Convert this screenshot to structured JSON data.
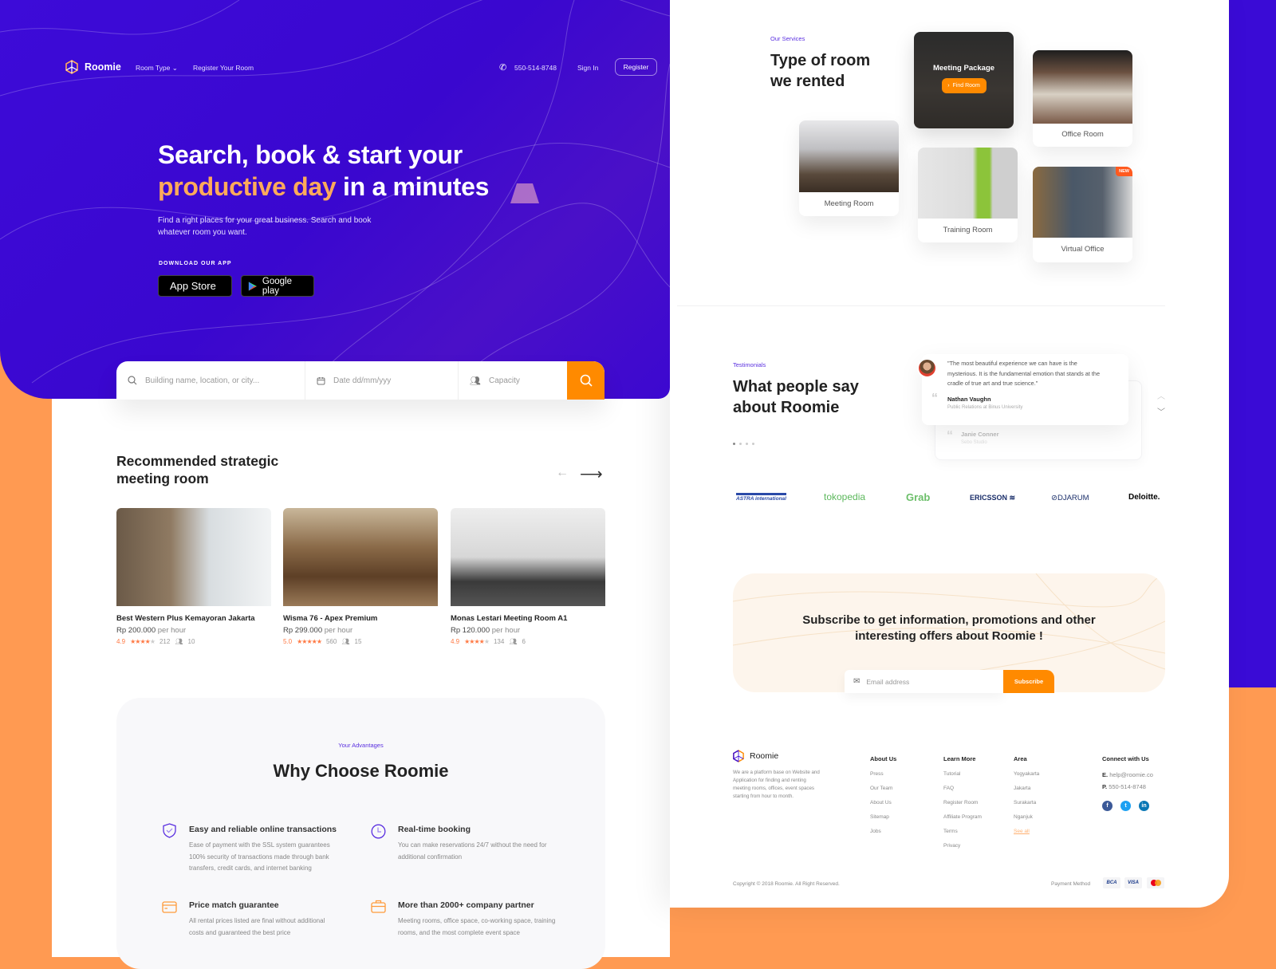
{
  "colors": {
    "brand_purple": "#3a0bd6",
    "accent_orange": "#ff8a00",
    "highlight_orange": "#ffaa5a",
    "star": "#ff7a45"
  },
  "nav": {
    "brand": "Roomie",
    "room_type": "Room Type",
    "register_room": "Register Your Room",
    "phone": "550-514-8748",
    "sign_in": "Sign In",
    "register": "Register"
  },
  "hero": {
    "title_line1": "Search, book & start your",
    "title_highlight": "productive day",
    "title_rest": " in a minutes",
    "subtitle": "Find a right places for your great business. Search and book whatever room you want.",
    "download_label": "DOWNLOAD OUR APP",
    "app_store": "App Store",
    "google_play": "Google play"
  },
  "search": {
    "location_placeholder": "Building name, location, or city...",
    "date_placeholder": "Date dd/mm/yyy",
    "capacity_placeholder": "Capacity"
  },
  "recommended": {
    "title_line1": "Recommended strategic",
    "title_line2": "meeting room",
    "rooms": [
      {
        "name": "Best Western Plus Kemayoran Jakarta",
        "price": "Rp 200.000",
        "unit": "per hour",
        "rating": "4.9",
        "stars": 4,
        "reviews": "212",
        "capacity": "10"
      },
      {
        "name": "Wisma 76 - Apex Premium",
        "price": "Rp 299.000",
        "unit": "per hour",
        "rating": "5.0",
        "stars": 5,
        "reviews": "560",
        "capacity": "15"
      },
      {
        "name": "Monas Lestari Meeting Room A1",
        "price": "Rp 120.000",
        "unit": "per hour",
        "rating": "4.9",
        "stars": 4,
        "reviews": "134",
        "capacity": "6"
      }
    ]
  },
  "advantages": {
    "label": "Your Advantages",
    "title": "Why Choose Roomie",
    "items": [
      {
        "icon": "shield-check-icon",
        "title": "Easy and reliable online transactions",
        "desc": "Ease of payment with the SSL system guarantees 100% security of transactions made through bank transfers, credit cards, and internet banking"
      },
      {
        "icon": "clock-icon",
        "title": "Real-time booking",
        "desc": "You can make reservations 24/7 without the need for additional confirmation"
      },
      {
        "icon": "credit-card-icon",
        "title": "Price match guarantee",
        "desc": "All rental prices listed are final without additional costs and guaranteed the best price"
      },
      {
        "icon": "briefcase-icon",
        "title": "More than 2000+ company partner",
        "desc": "Meeting rooms, office space, co-working space, training rooms, and the most complete event space"
      }
    ]
  },
  "services": {
    "label": "Our Services",
    "title_line1": "Type of room",
    "title_line2": "we rented",
    "package_title": "Meeting Package",
    "find_room": "Find Room",
    "rooms": {
      "office": "Office Room",
      "meeting": "Meeting Room",
      "training": "Training Room",
      "virtual": "Virtual Office"
    },
    "new_badge": "NEW"
  },
  "testimonials": {
    "label": "Testimonials",
    "title_line1": "What people say",
    "title_line2": "about Roomie",
    "active": {
      "quote": "\"The most beautiful experience we can have is the mysterious. It is the fundamental emotion that stands at the cradle of true art and true science.\"",
      "name": "Nathan Vaughn",
      "role": "Public Relations at Binus University"
    },
    "next": {
      "name": "Janie Conner",
      "role": "Sebo Studio"
    }
  },
  "partners": [
    "ASTRA international",
    "tokopedia",
    "Grab",
    "ERICSSON",
    "DJARUM",
    "Deloitte."
  ],
  "subscribe": {
    "title_line1": "Subscribe to get information, promotions and other",
    "title_line2": "interesting offers about Roomie !",
    "email_placeholder": "Email address",
    "button": "Subscribe"
  },
  "footer": {
    "brand": "Roomie",
    "desc": "We are a platform base on Website and Application for finding and renting meeting rooms, offices, event spaces starting from hour to month.",
    "columns": [
      {
        "heading": "About Us",
        "items": [
          "Press",
          "Our Team",
          "About Us",
          "Sitemap",
          "Jobs"
        ]
      },
      {
        "heading": "Learn More",
        "items": [
          "Tutorial",
          "FAQ",
          "Register Room",
          "Affiliate Program",
          "Terms",
          "Privacy"
        ]
      },
      {
        "heading": "Area",
        "items": [
          "Yogyakarta",
          "Jakarta",
          "Surakarta",
          "Nganjuk",
          "See all"
        ]
      }
    ],
    "connect": {
      "heading": "Connect with Us",
      "email_label": "E.",
      "email": "help@roomie.co",
      "phone_label": "P.",
      "phone": "550-514-8748"
    },
    "copyright": "Copyright © 2018 Roomie. All Right Reserved.",
    "payment_label": "Payment Method",
    "payments": [
      "BCA",
      "VISA",
      "Mastercard"
    ]
  }
}
